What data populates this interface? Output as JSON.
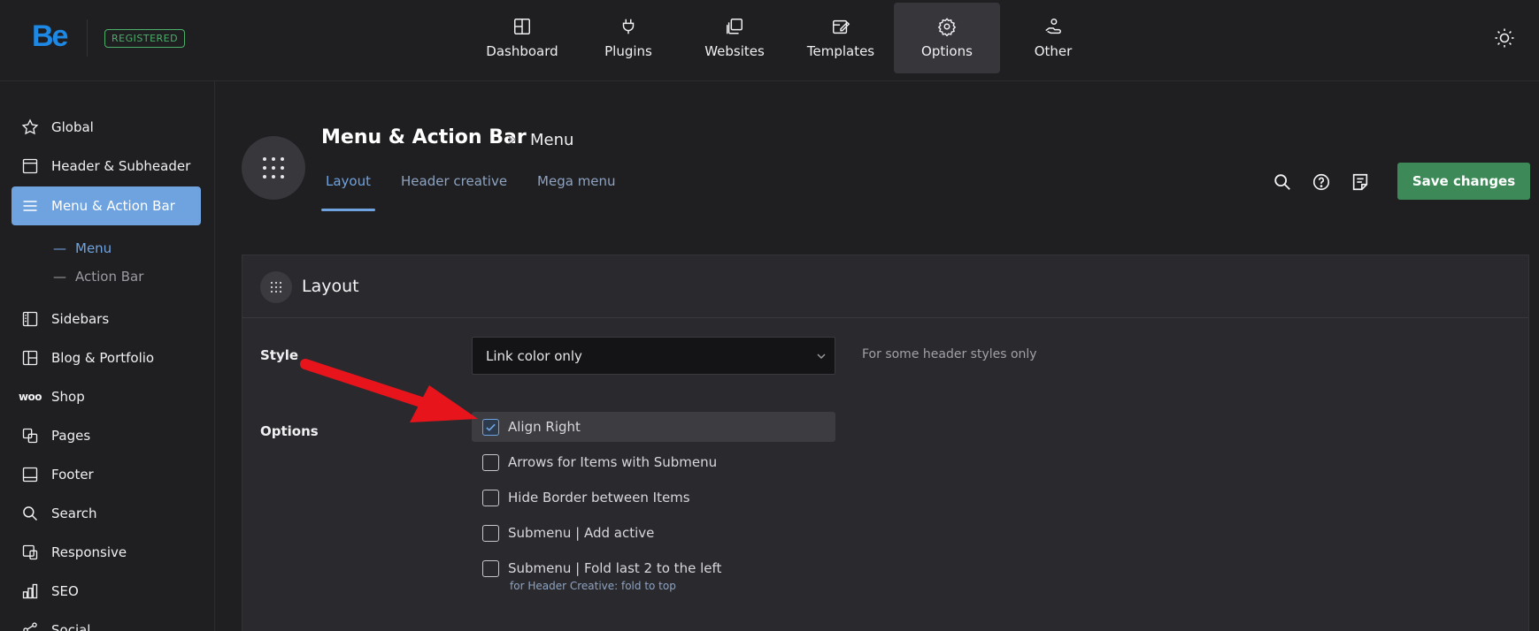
{
  "topbar": {
    "logo": "Be",
    "badge": "REGISTERED",
    "nav": [
      {
        "label": "Dashboard",
        "icon": "dashboard-icon"
      },
      {
        "label": "Plugins",
        "icon": "plug-icon"
      },
      {
        "label": "Websites",
        "icon": "websites-icon"
      },
      {
        "label": "Templates",
        "icon": "templates-icon"
      },
      {
        "label": "Options",
        "icon": "gear-icon",
        "active": true
      },
      {
        "label": "Other",
        "icon": "hand-icon"
      }
    ],
    "theme_icon": "sun-icon"
  },
  "sidebar": {
    "items": [
      {
        "label": "Global",
        "icon": "star-icon"
      },
      {
        "label": "Header & Subheader",
        "icon": "header-icon"
      },
      {
        "label": "Menu & Action Bar",
        "icon": "menu-icon",
        "active": true
      },
      {
        "label": "Sidebars",
        "icon": "sidebar-icon"
      },
      {
        "label": "Blog & Portfolio",
        "icon": "grid-icon"
      },
      {
        "label": "Shop",
        "icon": "woo-icon",
        "icon_text": "woo"
      },
      {
        "label": "Pages",
        "icon": "pages-icon"
      },
      {
        "label": "Footer",
        "icon": "footer-icon"
      },
      {
        "label": "Search",
        "icon": "search-icon"
      },
      {
        "label": "Responsive",
        "icon": "responsive-icon"
      },
      {
        "label": "SEO",
        "icon": "seo-icon"
      },
      {
        "label": "Social",
        "icon": "share-icon"
      }
    ],
    "subitems": [
      {
        "label": "Menu",
        "active": true
      },
      {
        "label": "Action Bar"
      }
    ],
    "sub_dash": "—"
  },
  "header": {
    "title": "Menu & Action Bar",
    "separator": "»",
    "crumb": "Menu",
    "tabs": [
      {
        "label": "Layout",
        "active": true
      },
      {
        "label": "Header creative"
      },
      {
        "label": "Mega menu"
      }
    ],
    "tools": [
      "search-icon",
      "help-icon",
      "notes-icon"
    ],
    "save_label": "Save changes"
  },
  "panel": {
    "title": "Layout",
    "style_label": "Style",
    "style_value": "Link color only",
    "style_desc": "For some header styles only",
    "options_label": "Options",
    "options": [
      {
        "label": "Align Right",
        "checked": true
      },
      {
        "label": "Arrows for Items with Submenu",
        "checked": false
      },
      {
        "label": "Hide Border between Items",
        "checked": false
      },
      {
        "label": "Submenu | Add active",
        "checked": false
      },
      {
        "label": "Submenu | Fold last 2 to the left",
        "checked": false,
        "note": "for Header Creative: fold to top"
      }
    ]
  },
  "colors": {
    "accent": "#6fa3df",
    "save": "#3d8a58",
    "annotation_arrow": "#e8141c",
    "badge": "#4caf6a"
  }
}
